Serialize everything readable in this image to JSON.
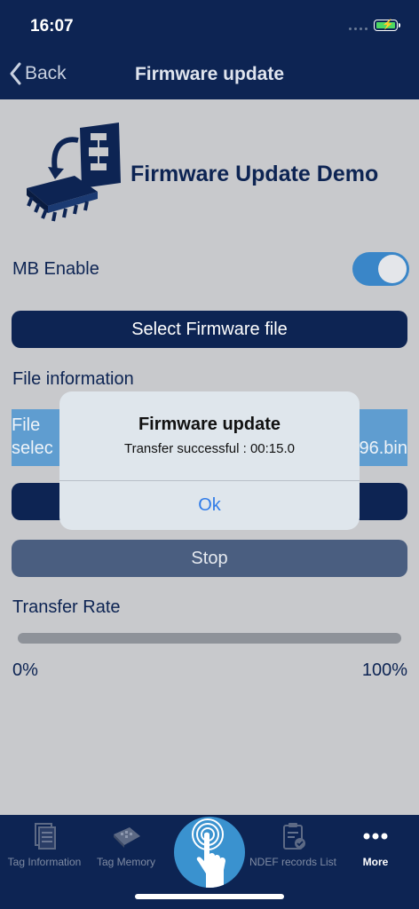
{
  "status": {
    "time": "16:07"
  },
  "nav": {
    "back_label": "Back",
    "title": "Firmware update"
  },
  "header": {
    "demo_title": "Firmware Update Demo"
  },
  "mb_enable": {
    "label": "MB Enable",
    "enabled": true
  },
  "select_button": {
    "label": "Select Firmware file"
  },
  "file_info": {
    "label": "File information",
    "line1": "File",
    "line2": "selec",
    "line2_tail": "96.bin"
  },
  "stop_button": {
    "label": "Stop"
  },
  "transfer": {
    "label": "Transfer Rate",
    "min_label": "0%",
    "max_label": "100%",
    "progress": 0
  },
  "dialog": {
    "title": "Firmware update",
    "message": "Transfer successful : 00:15.0",
    "ok_label": "Ok"
  },
  "tabs": [
    {
      "label": "Tag Information",
      "icon": "tag-information-icon"
    },
    {
      "label": "Tag Memory",
      "icon": "tag-memory-icon"
    },
    {
      "label": "",
      "icon": "nfc-touch-icon"
    },
    {
      "label": "NDEF records List",
      "icon": "ndef-records-icon"
    },
    {
      "label": "More",
      "icon": "more-icon"
    }
  ],
  "colors": {
    "navy": "#0d2453",
    "accent": "#3a86c8",
    "dialog_button": "#2f7be8"
  }
}
